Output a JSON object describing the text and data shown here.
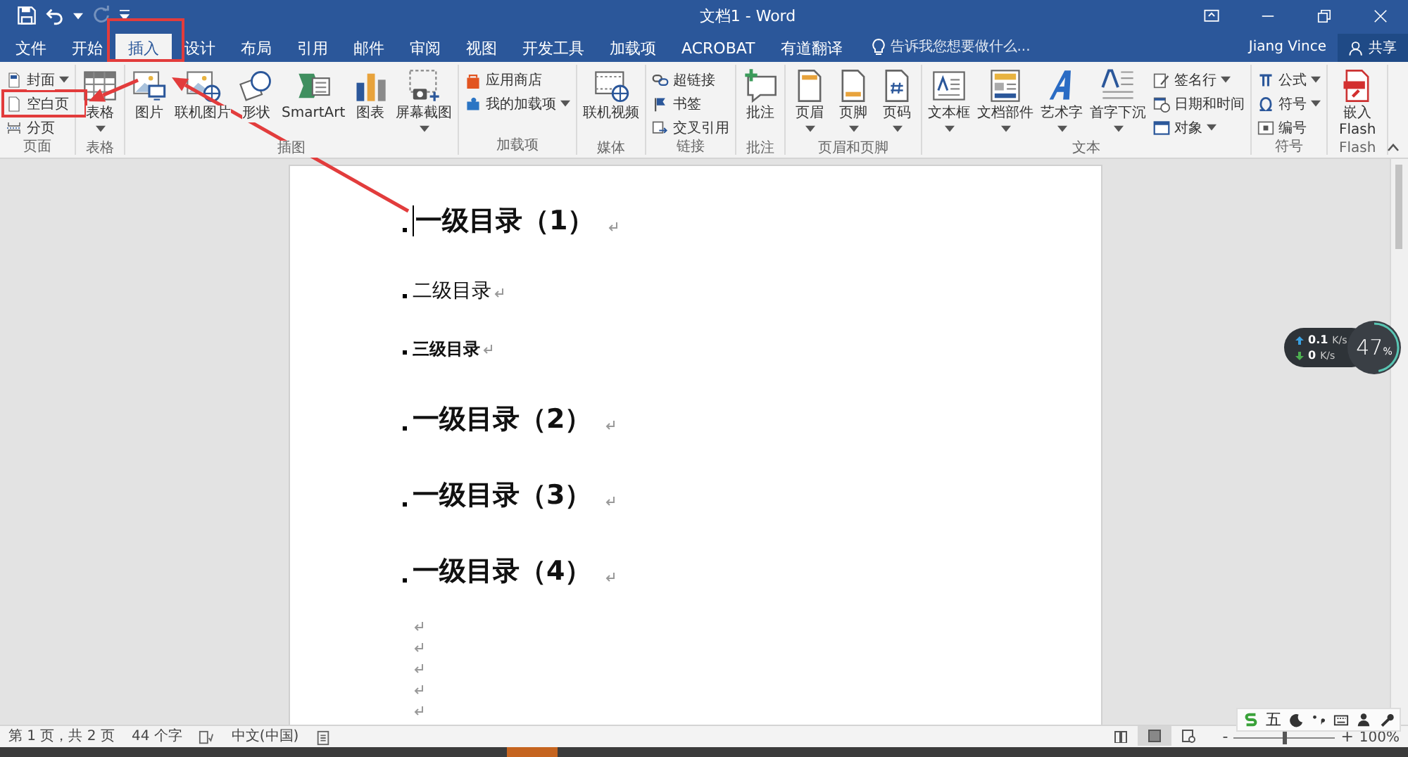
{
  "window": {
    "title": "文档1 - Word"
  },
  "quick_access": [
    {
      "kind": "save",
      "disabled": false
    },
    {
      "kind": "undo",
      "disabled": false
    },
    {
      "kind": "redo",
      "disabled": true
    },
    {
      "kind": "customize",
      "disabled": false
    }
  ],
  "tabs": [
    {
      "label": "文件",
      "selected": false
    },
    {
      "label": "开始",
      "selected": false
    },
    {
      "label": "插入",
      "selected": true
    },
    {
      "label": "设计",
      "selected": false
    },
    {
      "label": "布局",
      "selected": false
    },
    {
      "label": "引用",
      "selected": false
    },
    {
      "label": "邮件",
      "selected": false
    },
    {
      "label": "审阅",
      "selected": false
    },
    {
      "label": "视图",
      "selected": false
    },
    {
      "label": "开发工具",
      "selected": false
    },
    {
      "label": "加载项",
      "selected": false
    },
    {
      "label": "ACROBAT",
      "selected": false
    },
    {
      "label": "有道翻译",
      "selected": false
    }
  ],
  "tell_me": {
    "placeholder": "告诉我您想要做什么..."
  },
  "user": "Jiang Vince",
  "share_button": "共享",
  "ribbon": {
    "groups": [
      {
        "label": "页面",
        "items": [
          {
            "kind": "small",
            "label": "封面",
            "dropdown": true
          },
          {
            "kind": "small",
            "label": "空白页",
            "dropdown": false
          },
          {
            "kind": "small",
            "label": "分页",
            "dropdown": false
          }
        ]
      },
      {
        "label": "表格",
        "items": [
          {
            "kind": "large",
            "label": "表格",
            "dropdown": true
          }
        ]
      },
      {
        "label": "插图",
        "items": [
          {
            "kind": "large",
            "label": "图片",
            "dropdown": false
          },
          {
            "kind": "large",
            "label": "联机图片",
            "dropdown": false
          },
          {
            "kind": "large",
            "label": "形状",
            "dropdown": false
          },
          {
            "kind": "large",
            "label": "SmartArt",
            "dropdown": false
          },
          {
            "kind": "large",
            "label": "图表",
            "dropdown": false
          },
          {
            "kind": "large",
            "label": "屏幕截图",
            "dropdown": true
          }
        ]
      },
      {
        "label": "加载项",
        "items": [
          {
            "kind": "small",
            "label": "应用商店",
            "dropdown": false
          },
          {
            "kind": "small",
            "label": "我的加载项",
            "dropdown": true
          }
        ]
      },
      {
        "label": "媒体",
        "items": [
          {
            "kind": "large",
            "label": "联机视频",
            "dropdown": false
          }
        ]
      },
      {
        "label": "链接",
        "items": [
          {
            "kind": "small",
            "label": "超链接",
            "dropdown": false
          },
          {
            "kind": "small",
            "label": "书签",
            "dropdown": false
          },
          {
            "kind": "small",
            "label": "交叉引用",
            "dropdown": false
          }
        ]
      },
      {
        "label": "批注",
        "items": [
          {
            "kind": "large",
            "label": "批注",
            "dropdown": false
          }
        ]
      },
      {
        "label": "页眉和页脚",
        "items": [
          {
            "kind": "large",
            "label": "页眉",
            "dropdown": true
          },
          {
            "kind": "large",
            "label": "页脚",
            "dropdown": true
          },
          {
            "kind": "large",
            "label": "页码",
            "dropdown": true
          }
        ]
      },
      {
        "label": "文本",
        "items": [
          {
            "kind": "large",
            "label": "文本框",
            "dropdown": true
          },
          {
            "kind": "large",
            "label": "文档部件",
            "dropdown": true
          },
          {
            "kind": "large",
            "label": "艺术字",
            "dropdown": true
          },
          {
            "kind": "large",
            "label": "首字下沉",
            "dropdown": true
          },
          {
            "kind": "small",
            "label": "签名行",
            "dropdown": true
          },
          {
            "kind": "small",
            "label": "日期和时间",
            "dropdown": false
          },
          {
            "kind": "small",
            "label": "对象",
            "dropdown": true
          }
        ]
      },
      {
        "label": "符号",
        "items": [
          {
            "kind": "small",
            "label": "公式",
            "dropdown": true
          },
          {
            "kind": "small",
            "label": "符号",
            "dropdown": true
          },
          {
            "kind": "small",
            "label": "编号",
            "dropdown": false
          }
        ]
      },
      {
        "label": "Flash",
        "items": [
          {
            "kind": "large",
            "label": "嵌入 Flash",
            "dropdown": false
          }
        ]
      }
    ]
  },
  "document": {
    "paragraphs": [
      {
        "kind": "h1",
        "text": "一级目录（1）",
        "cursor": true
      },
      {
        "kind": "h2",
        "text": "二级目录",
        "cursor": false
      },
      {
        "kind": "h3",
        "text": "三级目录",
        "cursor": false
      },
      {
        "kind": "h1",
        "text": "一级目录（2）",
        "cursor": false
      },
      {
        "kind": "h1",
        "text": "一级目录（3）",
        "cursor": false
      },
      {
        "kind": "h1",
        "text": "一级目录（4）",
        "cursor": false
      },
      {
        "kind": "empty",
        "cursor": false
      },
      {
        "kind": "empty",
        "cursor": false
      },
      {
        "kind": "empty",
        "cursor": false
      },
      {
        "kind": "empty",
        "cursor": false
      },
      {
        "kind": "empty",
        "cursor": false
      }
    ]
  },
  "status_bar": {
    "page": "第 1 页，共 2 页",
    "words": "44 个字",
    "language": "中文(中国)",
    "views": [
      {
        "kind": "read",
        "selected": false
      },
      {
        "kind": "print",
        "selected": true
      },
      {
        "kind": "web",
        "selected": false
      }
    ],
    "zoom": {
      "minus": "-",
      "plus": "+",
      "level": 0.5,
      "percent": "100%"
    }
  },
  "ime_toolbar": {
    "mode": "五"
  },
  "net_monitor": {
    "upload": {
      "value": "0.1",
      "unit": "K/s"
    },
    "download": {
      "value": "0",
      "unit": "K/s"
    },
    "usage": {
      "value": "47",
      "unit": "%",
      "level": 0.47
    }
  }
}
